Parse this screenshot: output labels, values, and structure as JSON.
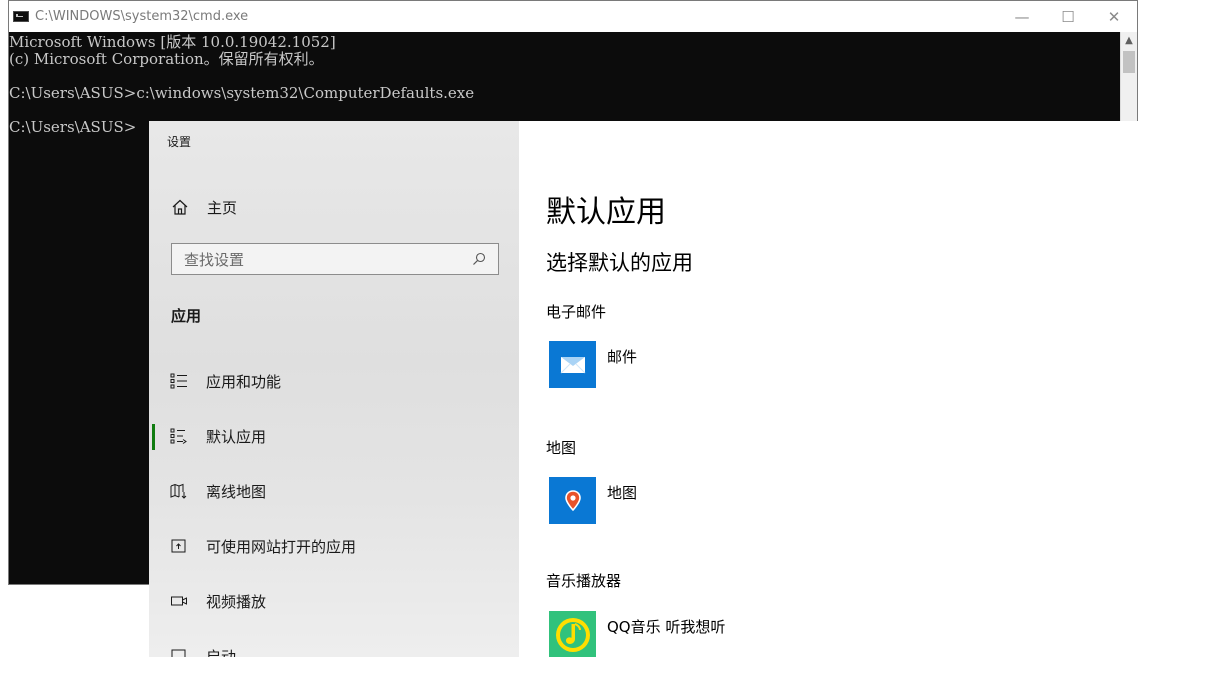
{
  "cmd": {
    "title": "C:\\WINDOWS\\system32\\cmd.exe",
    "lines": [
      "Microsoft Windows [版本 10.0.19042.1052]",
      "(c) Microsoft Corporation。保留所有权利。",
      "",
      "C:\\Users\\ASUS>c:\\windows\\system32\\ComputerDefaults.exe",
      "",
      "C:\\Users\\ASUS>"
    ],
    "minimize": "—",
    "maximize": "☐",
    "close": "✕"
  },
  "settings": {
    "caption": "设置",
    "home_label": "主页",
    "search_placeholder": "查找设置",
    "section_label": "应用",
    "nav_items": [
      {
        "label": "应用和功能",
        "icon": "apps-features-icon"
      },
      {
        "label": "默认应用",
        "icon": "default-apps-icon",
        "selected": true
      },
      {
        "label": "离线地图",
        "icon": "offline-maps-icon"
      },
      {
        "label": "可使用网站打开的应用",
        "icon": "apps-for-websites-icon"
      },
      {
        "label": "视频播放",
        "icon": "video-playback-icon"
      },
      {
        "label": "启动",
        "icon": "startup-icon"
      }
    ],
    "page_title": "默认应用",
    "subtitle": "选择默认的应用",
    "categories": [
      {
        "label": "电子邮件",
        "app": "邮件",
        "icon": "mail-app-icon",
        "color": "#0078d7"
      },
      {
        "label": "地图",
        "app": "地图",
        "icon": "maps-app-icon",
        "color": "#0078d7"
      },
      {
        "label": "音乐播放器",
        "app": "QQ音乐 听我想听",
        "icon": "qq-music-app-icon",
        "color": "#31c27c"
      }
    ]
  }
}
